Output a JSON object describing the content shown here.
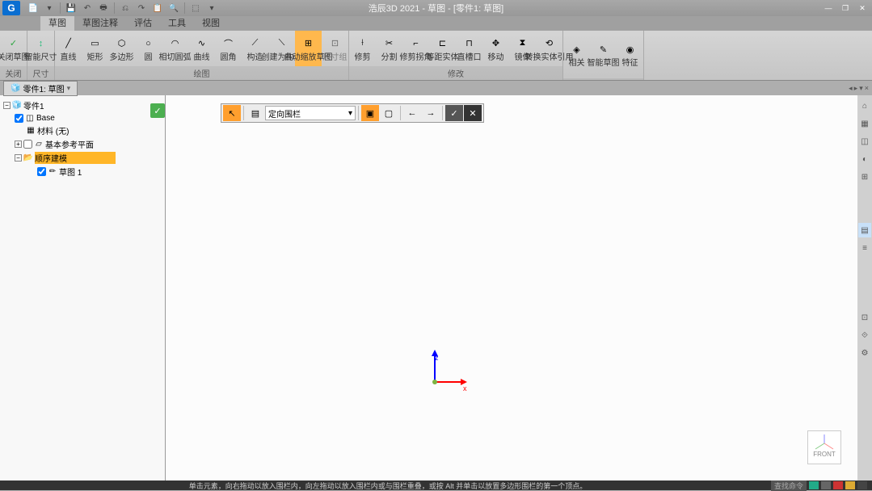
{
  "title": "浩辰3D 2021 - 草图 - [零件1: 草图]",
  "tabs": [
    "草图",
    "草图注释",
    "评估",
    "工具",
    "视图"
  ],
  "ribbon": {
    "groups": [
      {
        "label": "关闭",
        "buttons": [
          {
            "name": "close-sketch",
            "label": "关闭草图",
            "icon": "✓",
            "color": "#2da640"
          }
        ]
      },
      {
        "label": "尺寸",
        "buttons": [
          {
            "name": "smart-dim",
            "label": "智能尺寸",
            "icon": "↕",
            "color": "#2b7"
          }
        ]
      },
      {
        "label": "绘图",
        "buttons": [
          {
            "name": "line",
            "label": "直线",
            "icon": "╱"
          },
          {
            "name": "rect",
            "label": "矩形",
            "icon": "▭"
          },
          {
            "name": "polygon",
            "label": "多边形",
            "icon": "⬡"
          },
          {
            "name": "circle",
            "label": "圆",
            "icon": "○"
          },
          {
            "name": "tangent-arc",
            "label": "相切圆弧",
            "icon": "◠"
          },
          {
            "name": "spline",
            "label": "曲线",
            "icon": "∿"
          },
          {
            "name": "fillet",
            "label": "圆角",
            "icon": "⌒"
          },
          {
            "name": "construct",
            "label": "构造",
            "icon": "⟋"
          },
          {
            "name": "create-construct",
            "label": "创建为构造",
            "icon": "⟍"
          },
          {
            "name": "auto-scale",
            "label": "自动缩放草图",
            "icon": "⊞",
            "highlighted": true
          },
          {
            "name": "dim-grp",
            "label": "尺寸组",
            "icon": "⊡",
            "disabled": true
          }
        ]
      },
      {
        "label": "修改",
        "buttons": [
          {
            "name": "trim",
            "label": "修剪",
            "icon": "⟊"
          },
          {
            "name": "split",
            "label": "分割",
            "icon": "✂"
          },
          {
            "name": "trim-corner",
            "label": "修剪拐角",
            "icon": "⌐"
          },
          {
            "name": "offset",
            "label": "等距实体",
            "icon": "⊏"
          },
          {
            "name": "slot",
            "label": "直槽口",
            "icon": "⊓"
          },
          {
            "name": "move",
            "label": "移动",
            "icon": "✥"
          },
          {
            "name": "mirror",
            "label": "镜像",
            "icon": "⧗"
          },
          {
            "name": "convert",
            "label": "转换实体引用",
            "icon": "⟲"
          }
        ]
      },
      {
        "label": "",
        "buttons": [
          {
            "name": "relations",
            "label": "相关",
            "icon": "◈"
          },
          {
            "name": "smart-sketch",
            "label": "智能草图",
            "icon": "✎"
          },
          {
            "name": "features",
            "label": "特征",
            "icon": "◉"
          }
        ]
      }
    ]
  },
  "doc_tab": {
    "label": "零件1: 草图"
  },
  "tree": {
    "root": "零件1",
    "base": "Base",
    "material": "材料 (无)",
    "ref_plane": "基本参考平面",
    "seq_model": "顺序建模",
    "sketch1": "草图 1"
  },
  "floating_toolbar": {
    "combo_value": "定向围栏"
  },
  "axis": {
    "z": "z",
    "x": "x"
  },
  "view_cube": "FRONT",
  "status": {
    "hint": "单击元素，向右拖动以放入围栏内，向左拖动以放入围栏内或与围栏重叠，或按 Alt 并单击以放置多边形围栏的第一个顶点。",
    "cmd_placeholder": "查找命令"
  }
}
